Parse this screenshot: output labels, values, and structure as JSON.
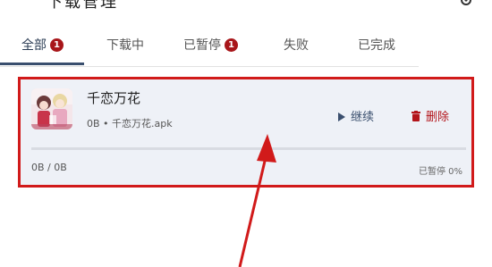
{
  "header": {
    "title": "下载管理"
  },
  "tabs": [
    {
      "label": "全部",
      "badge": "1",
      "active": true
    },
    {
      "label": "下载中",
      "badge": ""
    },
    {
      "label": "已暂停",
      "badge": "1"
    },
    {
      "label": "失败",
      "badge": ""
    },
    {
      "label": "已完成",
      "badge": ""
    }
  ],
  "download": {
    "name": "千恋万花",
    "meta": "0B • 千恋万花.apk",
    "continue_label": "继续",
    "delete_label": "删除",
    "size": "0B / 0B",
    "status": "已暂停 0%",
    "progress_percent": 0
  },
  "colors": {
    "accent": "#3a4f6e",
    "badge": "#a8161a",
    "delete": "#b3141a",
    "highlight": "#d11a1a"
  }
}
